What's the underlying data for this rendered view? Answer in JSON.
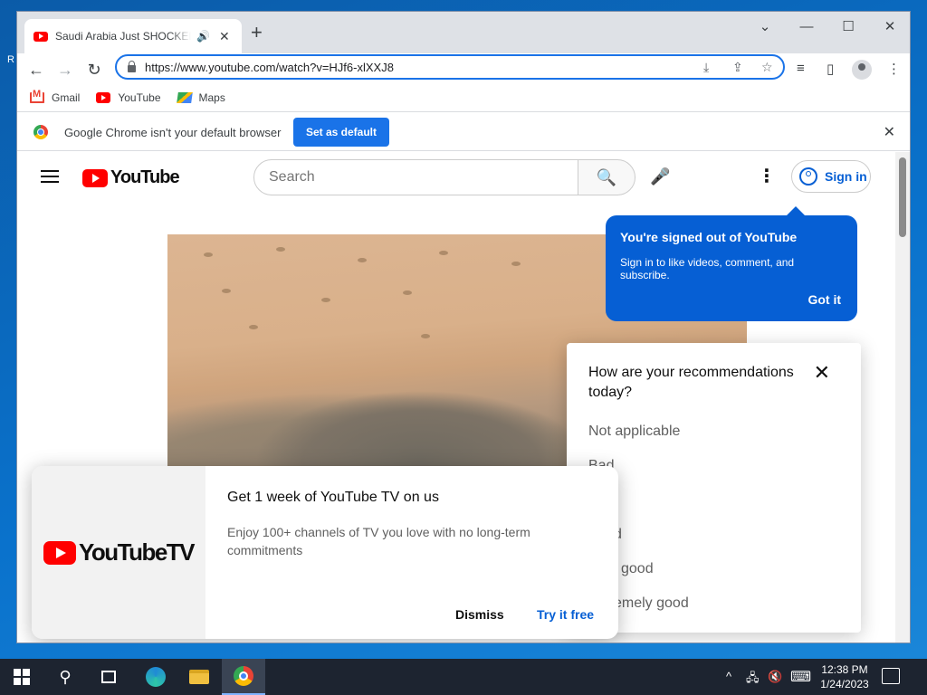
{
  "desktop": {
    "edge_glyph": "R"
  },
  "browser": {
    "tab": {
      "title": "Saudi Arabia Just SHOCKED",
      "audio_icon": "🔊",
      "close_icon": "✕"
    },
    "new_tab_icon": "+",
    "window_controls": {
      "collapse": "⌄",
      "minimize": "—",
      "maximize": "☐",
      "close": "✕"
    },
    "toolbar": {
      "back": "←",
      "forward": "→",
      "reload": "↻",
      "url": "https://www.youtube.com/watch?v=HJf6-xlXXJ8",
      "install_icon": "⤓",
      "share_icon": "⇪",
      "bookmark_icon": "☆",
      "media_icon": "≡",
      "sidepanel_icon": "▯",
      "menu_icon": "⋮"
    },
    "bookmarks": [
      {
        "label": "Gmail"
      },
      {
        "label": "YouTube"
      },
      {
        "label": "Maps"
      }
    ],
    "infobar": {
      "message": "Google Chrome isn't your default browser",
      "button": "Set as default",
      "close": "✕"
    }
  },
  "youtube": {
    "logo_text": "YouTube",
    "search_placeholder": "Search",
    "search_icon": "🔍",
    "mic_icon": "🎤",
    "more_icon": "⋮",
    "sign_in": "Sign in",
    "signed_out": {
      "title": "You're signed out of YouTube",
      "message": "Sign in to like videos, comment, and subscribe.",
      "button": "Got it"
    },
    "survey": {
      "title": "How are your recommendations today?",
      "close": "✕",
      "options": [
        "Not applicable",
        "Bad",
        "d",
        "good",
        "emely good"
      ]
    },
    "promo": {
      "logo_text": "YouTubeTV",
      "title": "Get 1 week of YouTube TV on us",
      "body": "Enjoy 100+ channels of TV you love with no long-term commitments",
      "dismiss": "Dismiss",
      "try": "Try it free"
    }
  },
  "taskbar": {
    "search_icon": "⚲",
    "tray": {
      "chevron": "^",
      "network": "🖧",
      "volume": "🔇",
      "keyboard": "⌨"
    },
    "time": "12:38 PM",
    "date": "1/24/2023"
  }
}
